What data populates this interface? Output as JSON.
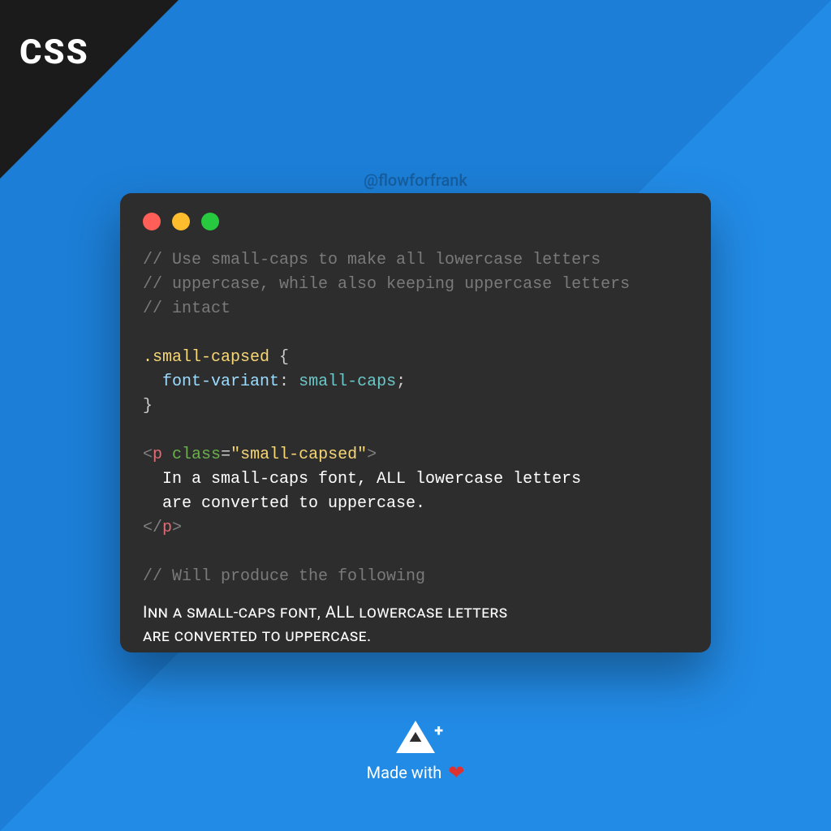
{
  "corner": {
    "label": "CSS"
  },
  "watermark": "@flowforfrank",
  "colors": {
    "bg_primary": "#1c7ed6",
    "bg_secondary": "#228be6",
    "corner": "#1b1b1b",
    "window": "#2d2d2d",
    "traffic_red": "#ff5f56",
    "traffic_yellow": "#ffbd2e",
    "traffic_green": "#27c93f",
    "heart": "#e03131"
  },
  "code": {
    "comment_line1": "// Use small-caps to make all lowercase letters",
    "comment_line2": "// uppercase, while also keeping uppercase letters",
    "comment_line3": "// intact",
    "selector": ".small-capsed",
    "brace_open": "{",
    "prop": "font-variant",
    "colon_space": ": ",
    "value": "small-caps",
    "semicolon": ";",
    "brace_close": "}",
    "lt": "<",
    "gt": ">",
    "slash": "/",
    "tag": "p",
    "attr_name": "class",
    "eq": "=",
    "quote_open": "\"",
    "attr_value": "small-capsed",
    "quote_close": "\"",
    "html_text_line1": "  In a small-caps font, ALL lowercase letters",
    "html_text_line2": "  are converted to uppercase.",
    "comment_result": "// Will produce the following"
  },
  "preview": {
    "line1": "Inn a small-caps font, ALL lowercase letters",
    "line2": "are converted to uppercase."
  },
  "footer": {
    "logo_plus": "+",
    "made_with": "Made with"
  }
}
